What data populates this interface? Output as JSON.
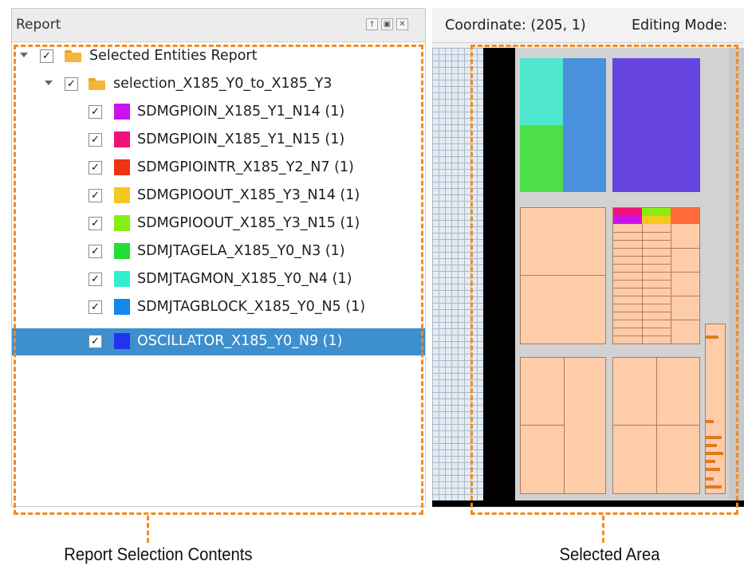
{
  "report": {
    "title": "Report",
    "header_buttons": {
      "pin": "pin-icon",
      "float": "float-icon",
      "close": "close-icon"
    },
    "rows": [
      {
        "label": "Selected Entities Report",
        "checked": true,
        "icon": "folder-icon",
        "expanded": true
      },
      {
        "label": "selection_X185_Y0_to_X185_Y3",
        "checked": true,
        "icon": "folder-icon",
        "expanded": true
      },
      {
        "label": "SDMGPIOIN_X185_Y1_N14 (1)",
        "checked": true,
        "color": "#cc11ee"
      },
      {
        "label": "SDMGPIOIN_X185_Y1_N15 (1)",
        "checked": true,
        "color": "#ee1177"
      },
      {
        "label": "SDMGPIOINTR_X185_Y2_N7 (1)",
        "checked": true,
        "color": "#ee3311"
      },
      {
        "label": "SDMGPIOOUT_X185_Y3_N14 (1)",
        "checked": true,
        "color": "#f5c81e"
      },
      {
        "label": "SDMGPIOOUT_X185_Y3_N15 (1)",
        "checked": true,
        "color": "#88ee11"
      },
      {
        "label": "SDMJTAGELA_X185_Y0_N3 (1)",
        "checked": true,
        "color": "#22dd33"
      },
      {
        "label": "SDMJTAGMON_X185_Y0_N4 (1)",
        "checked": true,
        "color": "#33eecc"
      },
      {
        "label": "SDMJTAGBLOCK_X185_Y0_N5 (1)",
        "checked": true,
        "color": "#1188ee"
      },
      {
        "label": "OSCILLATOR_X185_Y0_N9 (1)",
        "checked": true,
        "color": "#2233ee",
        "selected": true
      }
    ]
  },
  "chip_view": {
    "coordinate_text": "Coordinate: (205, 1)",
    "editing_mode_text": "Editing Mode:"
  },
  "colors": {
    "highlight_dash": "#f28b1e",
    "selection_bg": "#3d8fce",
    "block_fill": "#ffccaa",
    "jtagmon": "#4fe8cc",
    "jtagblock": "#4a90dc",
    "jtagela": "#4ee04a",
    "oscillator": "#6644e0"
  },
  "callouts": {
    "left": "Report Selection Contents",
    "right": "Selected Area"
  }
}
